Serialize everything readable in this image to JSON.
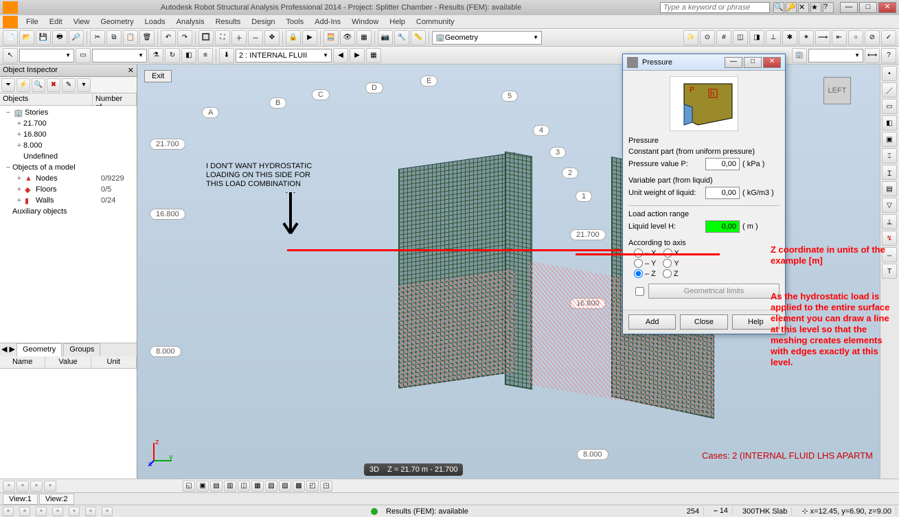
{
  "title": "Autodesk Robot Structural Analysis Professional 2014 - Project: Splitter Chamber - Results (FEM): available",
  "search_placeholder": "Type a keyword or phrase",
  "menu": [
    "File",
    "Edit",
    "View",
    "Geometry",
    "Loads",
    "Analysis",
    "Results",
    "Design",
    "Tools",
    "Add-Ins",
    "Window",
    "Help",
    "Community"
  ],
  "toolbar1_combo": "Geometry",
  "toolbar2_combo": "2 : INTERNAL FLUII",
  "inspector": {
    "title": "Object Inspector",
    "col_objects": "Objects",
    "col_number": "Number of...",
    "tree": {
      "stories": "Stories",
      "s1": "21.700",
      "s2": "16.800",
      "s3": "8.000",
      "undef": "Undefined",
      "model": "Objects of a model",
      "nodes": "Nodes",
      "nodes_n": "0/9229",
      "floors": "Floors",
      "floors_n": "0/5",
      "walls": "Walls",
      "walls_n": "0/24",
      "aux": "Auxiliary objects"
    },
    "tabs": {
      "geometry": "Geometry",
      "groups": "Groups"
    },
    "prop_cols": {
      "name": "Name",
      "value": "Value",
      "unit": "Unit"
    }
  },
  "viewport": {
    "exit": "Exit",
    "grid_top": {
      "a": "A",
      "b": "B",
      "c": "C",
      "d": "D",
      "e": "E"
    },
    "grid_side": {
      "g1": "1",
      "g2": "2",
      "g3": "3",
      "g4": "4",
      "g5": "5"
    },
    "levels": {
      "l1": "21.700",
      "l2": "16.800",
      "l3": "8.000"
    },
    "annot1": "I DON'T WANT HYDROSTATIC",
    "annot2": "LOADING ON THIS SIDE FOR",
    "annot3": "THIS LOAD COMBINATION",
    "cases": "Cases: 2 (INTERNAL FLUID LHS APARTM",
    "viewbar_mode": "3D",
    "viewbar_z": "Z = 21.70 m - 21.700"
  },
  "red_annot": {
    "line1": "Z coordinate in units of the example [m]",
    "para": "As the hydrostatic load is applied to the entire surface element you can draw a line at this level so that the meshing creates elements with edges exactly at this level."
  },
  "dialog": {
    "title": "Pressure",
    "sect_pressure": "Pressure",
    "constant_part": "Constant part (from uniform pressure)",
    "pressure_value_lbl": "Pressure value P:",
    "pressure_value": "0,00",
    "pressure_unit": "( kPa )",
    "variable_part": "Variable part (from liquid)",
    "unit_weight_lbl": "Unit weight of liquid:",
    "unit_weight": "0,00",
    "unit_weight_unit": "( kG/m3 )",
    "range": "Load action range",
    "liquid_level_lbl": "Liquid level H:",
    "liquid_level": "0,00",
    "liquid_level_unit": "( m )",
    "according": "According to axis",
    "axis": {
      "mx": "– X",
      "px": "X",
      "my": "– Y",
      "py": "Y",
      "mz": "– Z",
      "pz": "Z"
    },
    "geom_limits": "Geometrical limits",
    "add": "Add",
    "close": "Close",
    "help": "Help"
  },
  "cube_face": "LEFT",
  "viewtabs": {
    "v1": "View:1",
    "v2": "View:2"
  },
  "status": {
    "results": "Results (FEM): available",
    "n1": "254",
    "n2_icon": "⎯",
    "n2": "14",
    "slab": "300THK Slab",
    "coords": "x=12.45, y=6.90, z=9.00"
  }
}
